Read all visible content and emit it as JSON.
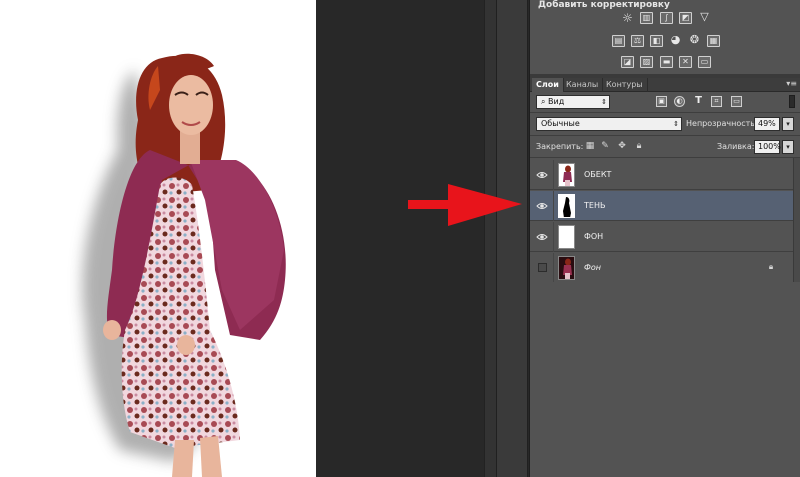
{
  "canvas": {
    "description_colors": {
      "background": "#ffffff",
      "jacket": "#8f2a52",
      "hair": "#9a2a1a",
      "skin": "#e8b59c"
    }
  },
  "annotation": {
    "arrow_color": "#e8141b"
  },
  "adjustments": {
    "title": "Добавить корректировку",
    "icons_row1": [
      "brightness-contrast-icon",
      "levels-icon",
      "curves-icon",
      "exposure-icon",
      "vibrance-icon"
    ],
    "icons_row2": [
      "hue-saturation-icon",
      "color-balance-icon",
      "black-white-icon",
      "photo-filter-icon",
      "channel-mixer-icon",
      "color-lookup-icon"
    ],
    "icons_row3": [
      "invert-icon",
      "posterize-icon",
      "threshold-icon",
      "selective-color-icon",
      "gradient-map-icon"
    ]
  },
  "layers_panel": {
    "tabs": [
      {
        "label": "Слои",
        "active": true
      },
      {
        "label": "Каналы",
        "active": false
      },
      {
        "label": "Контуры",
        "active": false
      }
    ],
    "filter": {
      "label": "Вид"
    },
    "blend_mode": "Обычные",
    "opacity_label": "Непрозрачность:",
    "opacity_value": "49%",
    "lock_label": "Закрепить:",
    "fill_label": "Заливка:",
    "fill_value": "100%",
    "layers": [
      {
        "name": "ОБЕКТ",
        "visible": true,
        "selected": false,
        "locked": false,
        "italic": false
      },
      {
        "name": "ТЕНЬ",
        "visible": true,
        "selected": true,
        "locked": false,
        "italic": false
      },
      {
        "name": "ФОН",
        "visible": true,
        "selected": false,
        "locked": false,
        "italic": false
      },
      {
        "name": "Фон",
        "visible": false,
        "selected": false,
        "locked": true,
        "italic": true
      }
    ]
  },
  "colors": {
    "panel_bg": "#535353",
    "selected_layer": "#566173",
    "workspace": "#282828"
  }
}
